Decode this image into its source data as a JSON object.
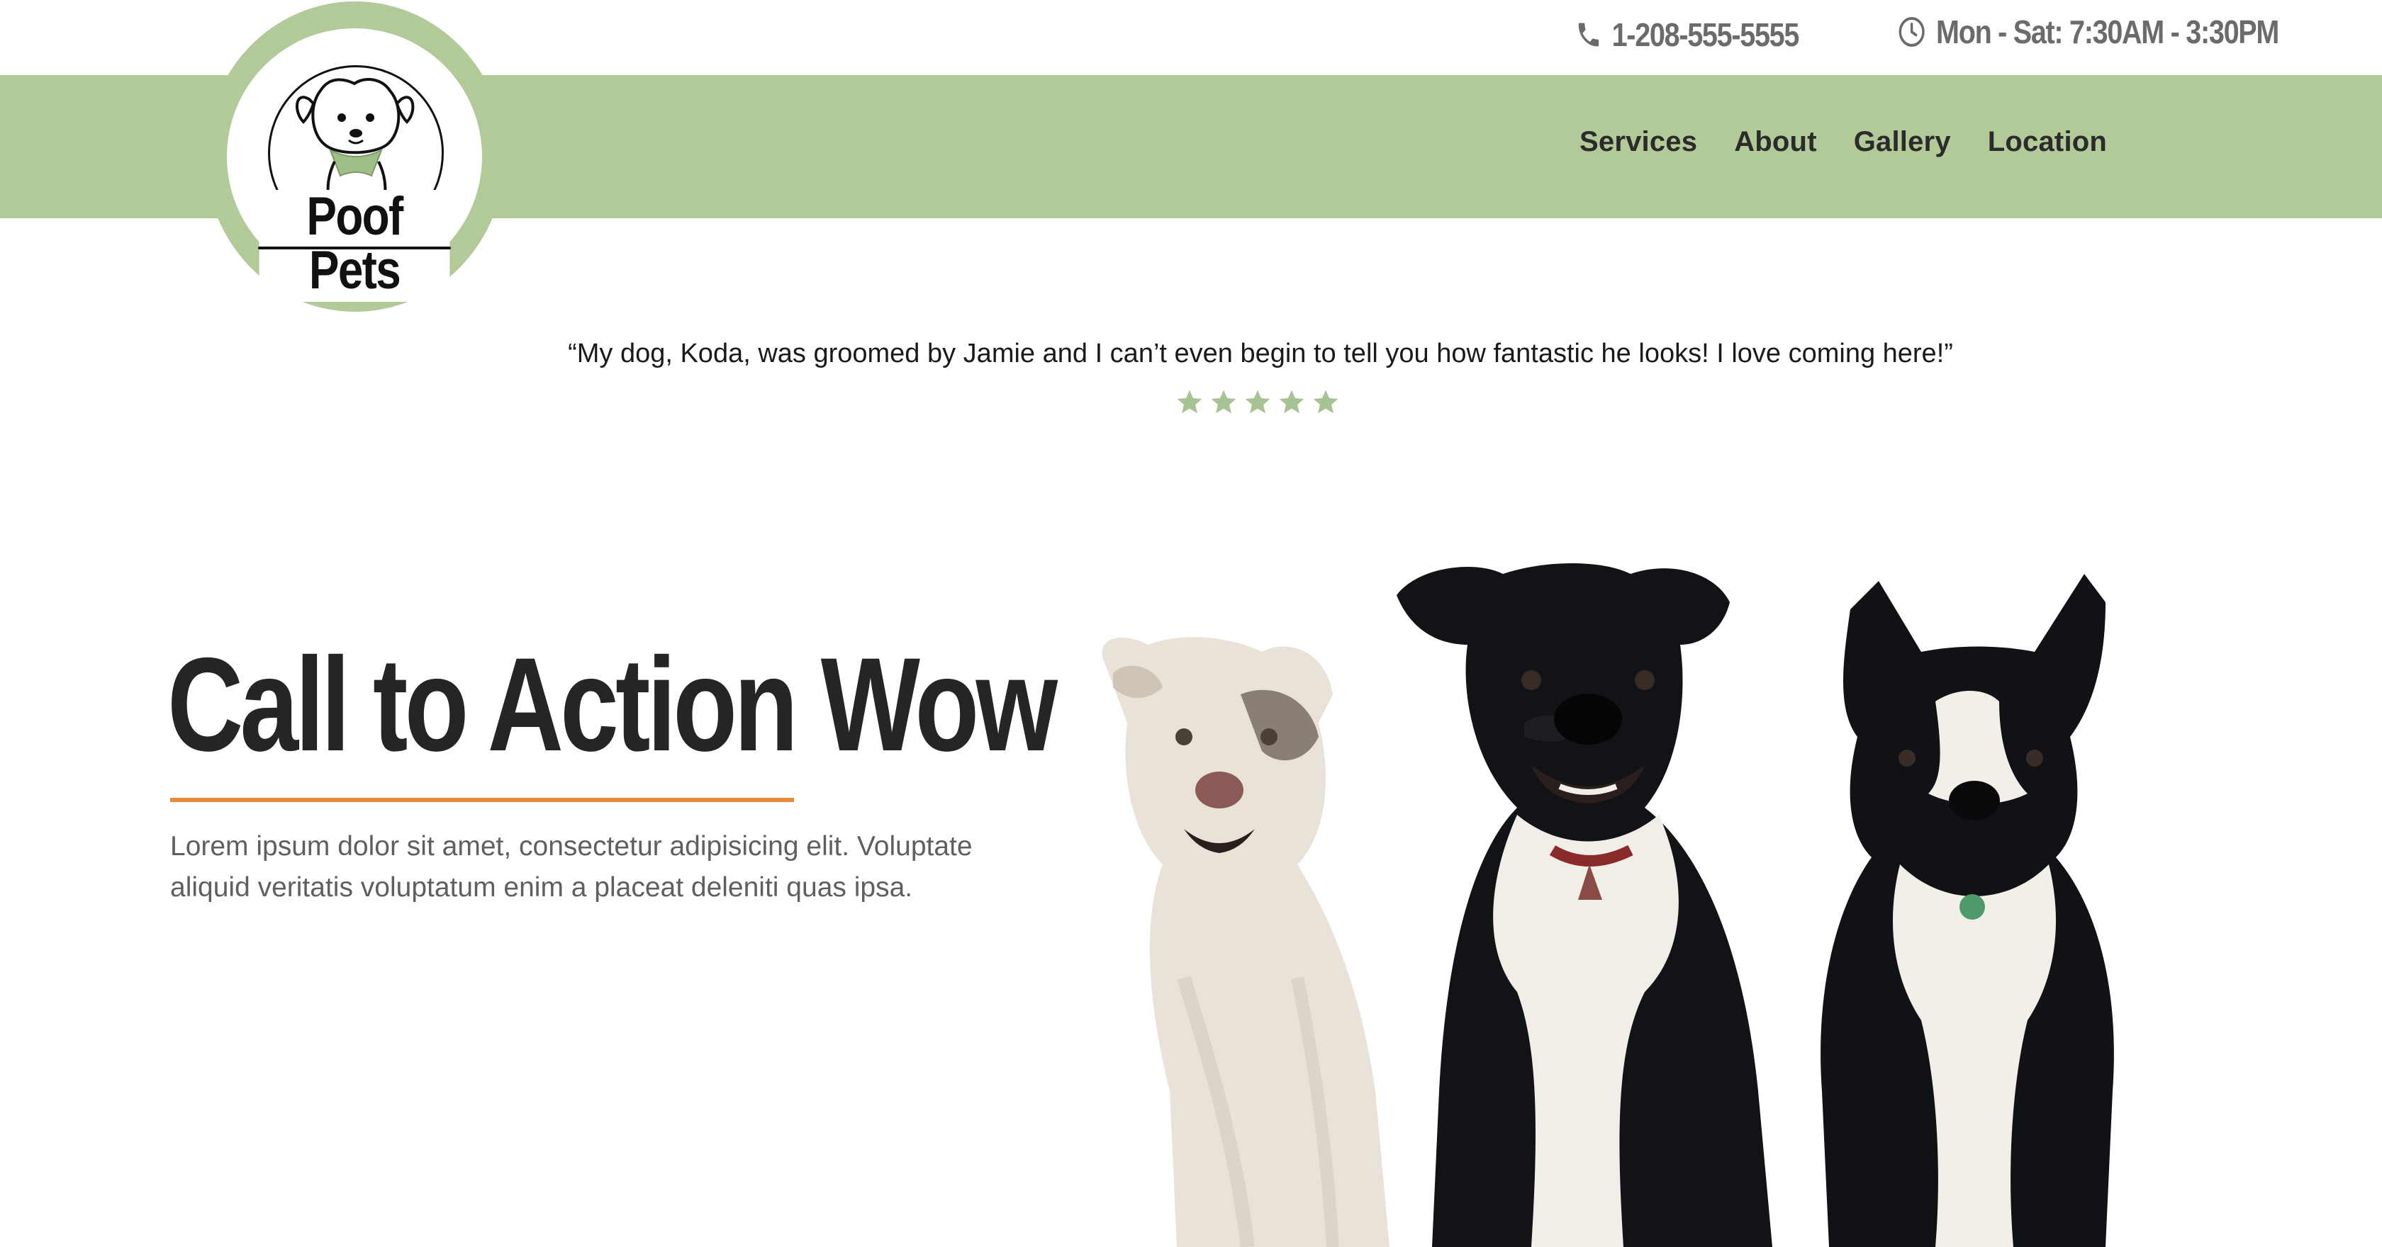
{
  "contact": {
    "phone": "1-208-555-5555",
    "hours": "Mon - Sat: 7:30AM - 3:30PM",
    "phone_icon": "phone-icon",
    "hours_icon": "clock-icon"
  },
  "brand": {
    "name": "Poof Pets",
    "logo_icon": "dog-logo-icon"
  },
  "nav": {
    "items": [
      {
        "label": "Services"
      },
      {
        "label": "About"
      },
      {
        "label": "Gallery"
      },
      {
        "label": "Location"
      }
    ]
  },
  "testimonial": {
    "quote": "“My dog, Koda, was groomed by Jamie and I can’t even begin to tell you how fantastic he looks! I love coming here!”",
    "rating": 5,
    "rating_max": 5
  },
  "hero": {
    "title": "Call to Action Wow",
    "body": "Lorem ipsum dolor sit amet, consectetur adipisicing elit. Voluptate aliquid veritatis voluptatum enim a placeat deleniti quas ipsa.",
    "image_icon": "three-dogs-photo"
  },
  "colors": {
    "brand_green": "#b2ca98",
    "accent_orange": "#e88a3a",
    "heading": "#252525",
    "body_text": "#5f5f5f",
    "contact_text": "#6b6b6b"
  }
}
